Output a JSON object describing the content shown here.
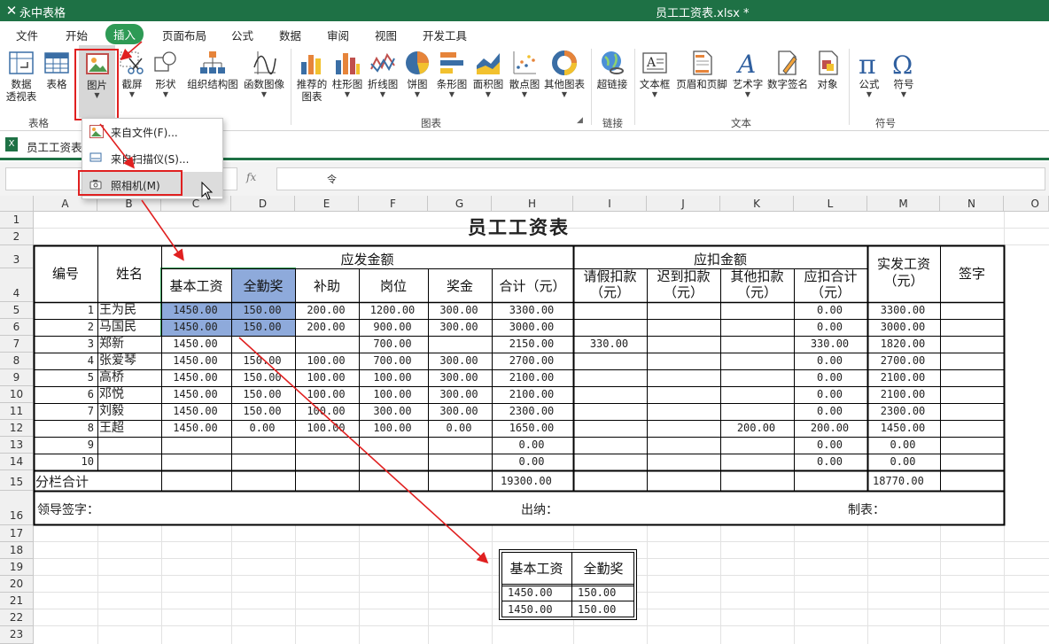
{
  "app": {
    "name": "永中表格",
    "document_title": "员工工资表.xlsx *"
  },
  "menu": [
    "文件",
    "开始",
    "插入",
    "页面布局",
    "公式",
    "数据",
    "审阅",
    "视图",
    "开发工具"
  ],
  "active_menu": "插入",
  "ribbon": {
    "buttons": {
      "pivot": "数据\n透视表",
      "table": "表格",
      "picture": "图片",
      "screenshot": "截屏",
      "shape": "形状",
      "orgchart": "组织结构图",
      "funcimage": "函数图像",
      "recommended": "推荐的\n图表",
      "bar": "柱形图",
      "line": "折线图",
      "pie": "饼图",
      "hbar": "条形图",
      "area": "面积图",
      "scatter": "散点图",
      "other": "其他图表",
      "hyperlink": "超链接",
      "textbox": "文本框",
      "headerfooter": "页眉和页脚",
      "arttext": "艺术字",
      "signature": "数字签名",
      "object": "对象",
      "formula": "公式",
      "symbol": "符号"
    },
    "groups": {
      "table": "表格",
      "chart": "图表",
      "link": "链接",
      "text": "文本",
      "symbol": "符号"
    }
  },
  "dropdown": {
    "from_file": "来自文件(F)...",
    "from_scanner": "来自扫描仪(S)...",
    "camera": "照相机(M)"
  },
  "sheet_tab": "员工工资表",
  "formula_bar": {
    "fx": "fx",
    "content": "",
    "formula_text": "令"
  },
  "columns": [
    "A",
    "B",
    "C",
    "D",
    "E",
    "F",
    "G",
    "H",
    "I",
    "J",
    "K",
    "L",
    "M",
    "N",
    "O"
  ],
  "rows": [
    "1",
    "2",
    "3",
    "4",
    "5",
    "6",
    "7",
    "8",
    "9",
    "10",
    "11",
    "12",
    "13",
    "14",
    "15",
    "16",
    "17",
    "18",
    "19",
    "20",
    "21",
    "22",
    "23"
  ],
  "sheet": {
    "title": "员工工资表",
    "h_id": "编号",
    "h_name": "姓名",
    "h_payable": "应发金额",
    "h_deduct": "应扣金额",
    "h_actual": "实发工资\n（元）",
    "h_sign": "签字",
    "h_base": "基本工资",
    "h_attendance": "全勤奖",
    "h_subsidy": "补助",
    "h_post": "岗位",
    "h_bonus": "奖金",
    "h_total": "合计（元）",
    "h_leave": "请假扣款\n（元）",
    "h_late": "迟到扣款\n（元）",
    "h_otherded": "其他扣款\n（元）",
    "h_dedtotal": "应扣合计\n（元）",
    "data_rows": [
      [
        "1",
        "王为民",
        "1450.00",
        "150.00",
        "200.00",
        "1200.00",
        "300.00",
        "3300.00",
        "",
        "",
        "",
        "0.00",
        "3300.00"
      ],
      [
        "2",
        "马国民",
        "1450.00",
        "150.00",
        "200.00",
        "900.00",
        "300.00",
        "3000.00",
        "",
        "",
        "",
        "0.00",
        "3000.00"
      ],
      [
        "3",
        "郑新",
        "1450.00",
        "",
        "",
        "700.00",
        "",
        "2150.00",
        "330.00",
        "",
        "",
        "330.00",
        "1820.00"
      ],
      [
        "4",
        "张爱琴",
        "1450.00",
        "150.00",
        "100.00",
        "700.00",
        "300.00",
        "2700.00",
        "",
        "",
        "",
        "0.00",
        "2700.00"
      ],
      [
        "5",
        "高桥",
        "1450.00",
        "150.00",
        "100.00",
        "100.00",
        "300.00",
        "2100.00",
        "",
        "",
        "",
        "0.00",
        "2100.00"
      ],
      [
        "6",
        "邓悦",
        "1450.00",
        "150.00",
        "100.00",
        "100.00",
        "300.00",
        "2100.00",
        "",
        "",
        "",
        "0.00",
        "2100.00"
      ],
      [
        "7",
        "刘毅",
        "1450.00",
        "150.00",
        "100.00",
        "300.00",
        "300.00",
        "2300.00",
        "",
        "",
        "",
        "0.00",
        "2300.00"
      ],
      [
        "8",
        "王超",
        "1450.00",
        "0.00",
        "100.00",
        "100.00",
        "0.00",
        "1650.00",
        "",
        "",
        "200.00",
        "200.00",
        "1450.00"
      ],
      [
        "9",
        "",
        "",
        "",
        "",
        "",
        "",
        "0.00",
        "",
        "",
        "",
        "0.00",
        "0.00"
      ],
      [
        "10",
        "",
        "",
        "",
        "",
        "",
        "",
        "0.00",
        "",
        "",
        "",
        "0.00",
        "0.00"
      ]
    ],
    "subtotal_label": "分栏合计",
    "subtotal_payable": "19300.00",
    "subtotal_actual": "18770.00",
    "leader_sign": "领导签字：",
    "cashier": "出纳：",
    "maker": "制表："
  },
  "camera_copy": {
    "h_base": "基本工资",
    "h_attendance": "全勤奖",
    "rows": [
      [
        "1450.00",
        "150.00"
      ],
      [
        "1450.00",
        "150.00"
      ]
    ]
  },
  "colors": {
    "titlebar": "#1e7145",
    "active_tab": "#2e9a55",
    "annotation": "#e02020",
    "selection": "#8eaadb"
  }
}
